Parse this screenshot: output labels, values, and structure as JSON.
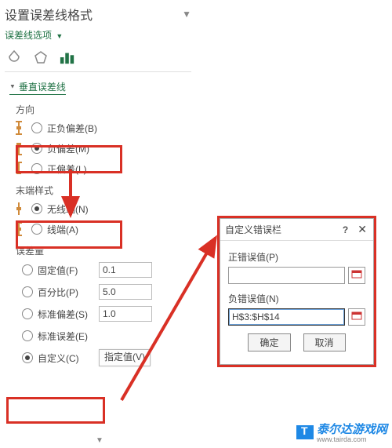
{
  "panel": {
    "title": "设置误差线格式",
    "dropdown": "误差线选项",
    "section": "垂直误差线",
    "direction": {
      "label": "方向",
      "opts": [
        {
          "label": "正负偏差(B)",
          "checked": false
        },
        {
          "label": "负偏差(M)",
          "checked": true
        },
        {
          "label": "正偏差(L)",
          "checked": false
        }
      ]
    },
    "endStyle": {
      "label": "末端样式",
      "opts": [
        {
          "label": "无线端(N)",
          "checked": true
        },
        {
          "label": "线端(A)",
          "checked": false
        }
      ]
    },
    "errorAmount": {
      "label": "误差量",
      "rows": [
        {
          "label": "固定值(F)",
          "value": "0.1",
          "checked": false
        },
        {
          "label": "百分比(P)",
          "value": "5.0",
          "checked": false
        },
        {
          "label": "标准偏差(S)",
          "value": "1.0",
          "checked": false
        },
        {
          "label": "标准误差(E)",
          "value": "",
          "checked": false
        }
      ],
      "custom": {
        "label": "自定义(C)",
        "button": "指定值(V)",
        "checked": true
      }
    }
  },
  "dialog": {
    "title": "自定义错误栏",
    "posLabel": "正错误值(P)",
    "posValue": "",
    "negLabel": "负错误值(N)",
    "negValue": "H$3:$H$14",
    "ok": "确定",
    "cancel": "取消"
  },
  "watermark": {
    "text": "泰尔达游戏网",
    "sub": "www.tairda.com"
  }
}
